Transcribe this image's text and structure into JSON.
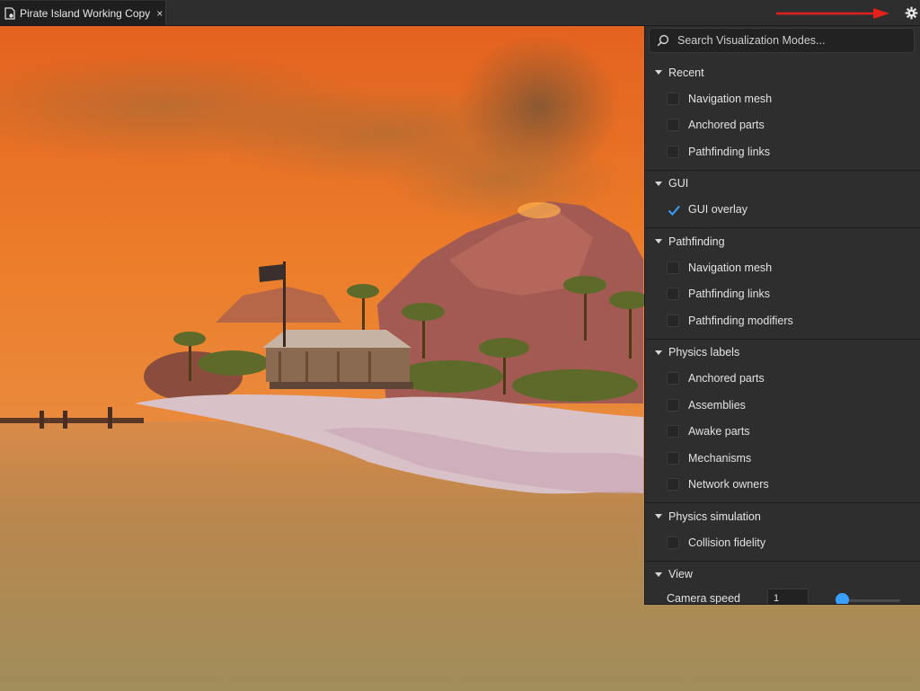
{
  "window": {
    "tab_title": "Pirate Island Working Copy",
    "close_glyph": "×"
  },
  "icons": {
    "document": "document-icon",
    "close": "close-icon",
    "settings": "gear-icon",
    "search": "search-icon",
    "collapse": "caret-down-icon",
    "checked": "checkmark-icon",
    "annotation": "red-arrow-icon"
  },
  "colors": {
    "panel_bg": "#2e2e2e",
    "accent": "#3aa0ff",
    "annotation_arrow": "#e3211b"
  },
  "panel": {
    "search_placeholder": "Search Visualization Modes...",
    "sections": [
      {
        "title": "Recent",
        "items": [
          {
            "label": "Navigation mesh",
            "checked": false
          },
          {
            "label": "Anchored parts",
            "checked": false
          },
          {
            "label": "Pathfinding links",
            "checked": false
          }
        ]
      },
      {
        "title": "GUI",
        "items": [
          {
            "label": "GUI overlay",
            "checked": true
          }
        ]
      },
      {
        "title": "Pathfinding",
        "items": [
          {
            "label": "Navigation mesh",
            "checked": false
          },
          {
            "label": "Pathfinding links",
            "checked": false
          },
          {
            "label": "Pathfinding modifiers",
            "checked": false
          }
        ]
      },
      {
        "title": "Physics labels",
        "items": [
          {
            "label": "Anchored parts",
            "checked": false
          },
          {
            "label": "Assemblies",
            "checked": false
          },
          {
            "label": "Awake parts",
            "checked": false
          },
          {
            "label": "Mechanisms",
            "checked": false
          },
          {
            "label": "Network owners",
            "checked": false
          }
        ]
      },
      {
        "title": "Physics simulation",
        "items": [
          {
            "label": "Collision fidelity",
            "checked": false
          }
        ]
      },
      {
        "title": "View",
        "items": [],
        "slider": {
          "label": "Camera speed",
          "value": "1",
          "fraction": 0
        }
      }
    ]
  }
}
